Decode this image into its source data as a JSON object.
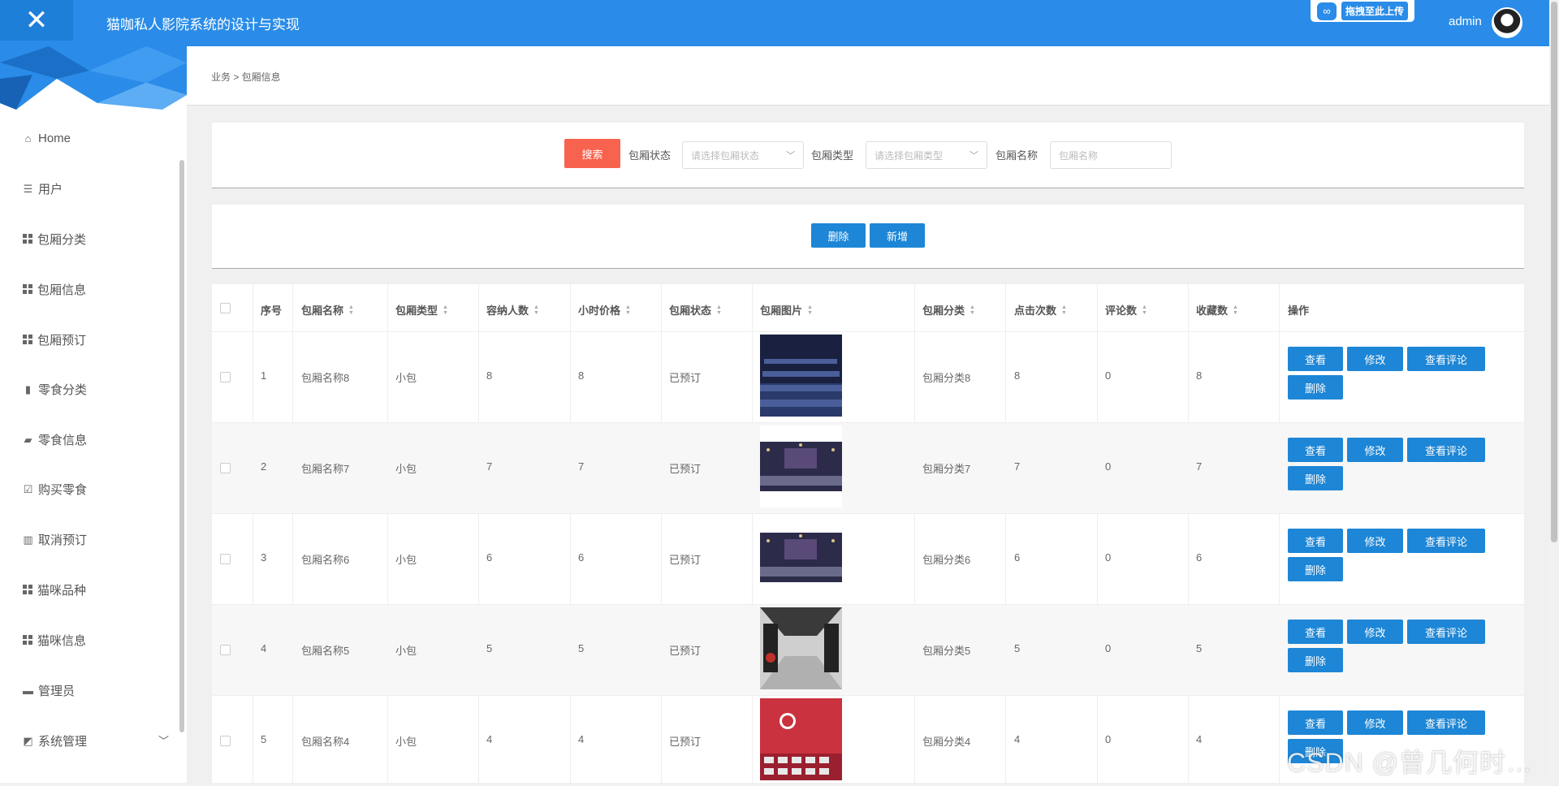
{
  "header": {
    "title": "猫咖私人影院系统的设计与实现",
    "upload_label": "拖拽至此上传",
    "user": "admin"
  },
  "sidebar": {
    "items": [
      {
        "label": "Home",
        "icon": "home-icon"
      },
      {
        "label": "用户",
        "icon": "list-icon"
      },
      {
        "label": "包厢分类",
        "icon": "grid-icon"
      },
      {
        "label": "包厢信息",
        "icon": "grid-icon"
      },
      {
        "label": "包厢预订",
        "icon": "grid-icon"
      },
      {
        "label": "零食分类",
        "icon": "book-icon"
      },
      {
        "label": "零食信息",
        "icon": "truck-icon"
      },
      {
        "label": "购买零食",
        "icon": "clipboard-icon"
      },
      {
        "label": "取消预订",
        "icon": "bar-chart-icon"
      },
      {
        "label": "猫咪品种",
        "icon": "grid-icon"
      },
      {
        "label": "猫咪信息",
        "icon": "grid-icon"
      },
      {
        "label": "管理员",
        "icon": "monitor-icon"
      },
      {
        "label": "系统管理",
        "icon": "line-chart-icon"
      }
    ]
  },
  "breadcrumb": "业务 > 包厢信息",
  "search": {
    "button": "搜索",
    "status_label": "包厢状态",
    "status_placeholder": "请选择包厢状态",
    "type_label": "包厢类型",
    "type_placeholder": "请选择包厢类型",
    "name_label": "包厢名称",
    "name_placeholder": "包厢名称"
  },
  "actions": {
    "delete": "删除",
    "add": "新增"
  },
  "table": {
    "headers": [
      "序号",
      "包厢名称",
      "包厢类型",
      "容纳人数",
      "小时价格",
      "包厢状态",
      "包厢图片",
      "包厢分类",
      "点击次数",
      "评论数",
      "收藏数",
      "操作"
    ],
    "rows": [
      {
        "no": "1",
        "name": "包厢名称8",
        "type": "小包",
        "capacity": "8",
        "price": "8",
        "status": "已预订",
        "category": "包厢分类8",
        "clicks": "8",
        "comments": "0",
        "favorites": "8"
      },
      {
        "no": "2",
        "name": "包厢名称7",
        "type": "小包",
        "capacity": "7",
        "price": "7",
        "status": "已预订",
        "category": "包厢分类7",
        "clicks": "7",
        "comments": "0",
        "favorites": "7"
      },
      {
        "no": "3",
        "name": "包厢名称6",
        "type": "小包",
        "capacity": "6",
        "price": "6",
        "status": "已预订",
        "category": "包厢分类6",
        "clicks": "6",
        "comments": "0",
        "favorites": "6"
      },
      {
        "no": "4",
        "name": "包厢名称5",
        "type": "小包",
        "capacity": "5",
        "price": "5",
        "status": "已预订",
        "category": "包厢分类5",
        "clicks": "5",
        "comments": "0",
        "favorites": "5"
      },
      {
        "no": "5",
        "name": "包厢名称4",
        "type": "小包",
        "capacity": "4",
        "price": "4",
        "status": "已预订",
        "category": "包厢分类4",
        "clicks": "4",
        "comments": "0",
        "favorites": "4"
      }
    ],
    "row_actions": {
      "view": "查看",
      "edit": "修改",
      "comments": "查看评论",
      "delete": "删除"
    }
  },
  "watermark": "CSDN @曾几何时…",
  "colors": {
    "primary": "#2a8ce8",
    "button": "#1d86d6",
    "search": "#f7634e"
  }
}
